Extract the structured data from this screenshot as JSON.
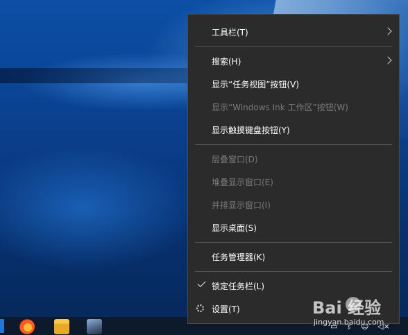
{
  "context_menu": {
    "items": [
      {
        "label": "工具栏(T)",
        "enabled": true,
        "submenu": true
      },
      {
        "label": "搜索(H)",
        "enabled": true,
        "submenu": true
      },
      {
        "label": "显示“任务视图”按钮(V)",
        "enabled": true
      },
      {
        "label": "显示“Windows Ink 工作区”按钮(W)",
        "enabled": false
      },
      {
        "label": "显示触摸键盘按钮(Y)",
        "enabled": true
      },
      {
        "label": "层叠窗口(D)",
        "enabled": false
      },
      {
        "label": "堆叠显示窗口(E)",
        "enabled": false
      },
      {
        "label": "并排显示窗口(I)",
        "enabled": false
      },
      {
        "label": "显示桌面(S)",
        "enabled": true
      },
      {
        "label": "任务管理器(K)",
        "enabled": true
      },
      {
        "label": "锁定任务栏(L)",
        "enabled": true,
        "checked": true
      },
      {
        "label": "设置(T)",
        "enabled": true,
        "icon": "gear-icon"
      }
    ]
  },
  "taskbar": {
    "icons": [
      "start-button",
      "firefox-icon",
      "file-explorer-icon",
      "photo-app-icon"
    ],
    "tray": [
      "network-icon",
      "bluetooth-icon",
      "emoji-icon",
      "volume-muted-icon"
    ]
  },
  "watermark": {
    "logo": "Bai  经验",
    "sub": "jingyan.baidu.com"
  }
}
